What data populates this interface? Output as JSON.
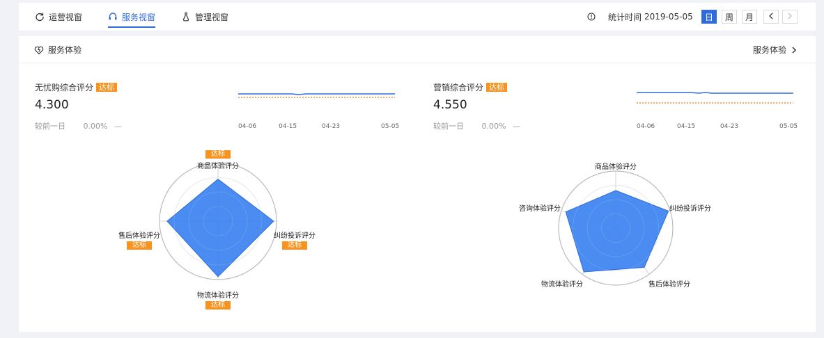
{
  "tabs": [
    {
      "label": "运营视窗",
      "icon": "refresh-icon",
      "active": false
    },
    {
      "label": "服务视窗",
      "icon": "headset-icon",
      "active": true
    },
    {
      "label": "管理视窗",
      "icon": "flask-icon",
      "active": false
    }
  ],
  "stat_time": {
    "label": "统计时间",
    "date": "2019-05-05",
    "icon": "info-icon"
  },
  "periods": [
    "日",
    "周",
    "月"
  ],
  "active_period": "日",
  "card": {
    "title": "服务体验",
    "title_icon": "heart-icon",
    "link": "服务体验"
  },
  "badge_text": "达标",
  "colors": {
    "accent": "#2f6bd9",
    "badge": "#f7931e",
    "radar_fill": "#3b82f0",
    "target_line": "#f07a1c"
  },
  "metrics": [
    {
      "name": "无忧购综合评分",
      "value": "4.300",
      "compare_label": "较前一日",
      "compare_pct": "0.00%",
      "compare_trend": "—",
      "badge": true,
      "x_ticks": [
        "04-06",
        "04-15",
        "04-23",
        "05-05"
      ]
    },
    {
      "name": "营销综合评分",
      "value": "4.550",
      "compare_label": "较前一日",
      "compare_pct": "0.00%",
      "compare_trend": "—",
      "badge": true,
      "x_ticks": [
        "04-06",
        "04-15",
        "04-23",
        "05-05"
      ]
    }
  ],
  "radars": [
    {
      "axes": [
        {
          "label": "商品体验评分",
          "value": 0.72,
          "badge": true
        },
        {
          "label": "纠纷投诉评分",
          "value": 0.95,
          "badge": true
        },
        {
          "label": "物流体验评分",
          "value": 0.95,
          "badge": true
        },
        {
          "label": "售后体验评分",
          "value": 0.87,
          "badge": true
        }
      ]
    },
    {
      "axes": [
        {
          "label": "商品体验评分",
          "value": 0.66,
          "badge": false
        },
        {
          "label": "纠纷投诉评分",
          "value": 0.97,
          "badge": false
        },
        {
          "label": "售后体验评分",
          "value": 0.85,
          "badge": false
        },
        {
          "label": "物流体验评分",
          "value": 0.95,
          "badge": false
        },
        {
          "label": "咨询体验评分",
          "value": 0.92,
          "badge": false
        }
      ]
    }
  ]
}
